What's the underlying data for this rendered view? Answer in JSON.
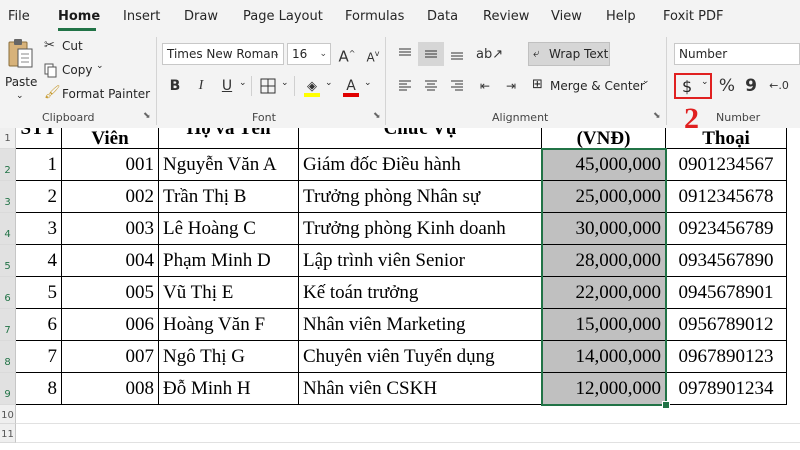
{
  "tabs": [
    "File",
    "Home",
    "Insert",
    "Draw",
    "Page Layout",
    "Formulas",
    "Data",
    "Review",
    "View",
    "Help",
    "Foxit PDF"
  ],
  "ribbon": {
    "clipboard": {
      "paste_label": "Paste",
      "cut_label": "Cut",
      "copy_label": "Copy",
      "format_painter_label": "Format Painter",
      "group_label": "Clipboard"
    },
    "font": {
      "font_name": "Times New Roman",
      "font_size": "16",
      "group_label": "Font",
      "bold": "B",
      "italic": "I",
      "underline": "U",
      "grow": "A",
      "shrink": "A",
      "font_color": "A"
    },
    "alignment": {
      "wrap_text_label": "Wrap Text",
      "merge_center_label": "Merge & Center",
      "group_label": "Alignment"
    },
    "number": {
      "format_value": "Number",
      "currency_symbol": "$",
      "percent_symbol": "%",
      "comma_symbol": "9",
      "group_label": "Number"
    }
  },
  "annotation": {
    "step_number": "2",
    "color": "#e02020"
  },
  "sheet": {
    "header": {
      "stt": "STT",
      "ma": "Viên",
      "hoten": "Họ và Tên",
      "chucvu": "Chức Vụ",
      "luong": "(VNĐ)",
      "sdt": "Thoại"
    },
    "row_numbers": [
      "1",
      "2",
      "3",
      "4",
      "5",
      "6",
      "7",
      "8",
      "9",
      "10",
      "11"
    ],
    "rows": [
      {
        "stt": "1",
        "ma": "001",
        "hoten": "Nguyễn Văn A",
        "chucvu": "Giám đốc Điều hành",
        "luong": "45,000,000",
        "sdt": "0901234567"
      },
      {
        "stt": "2",
        "ma": "002",
        "hoten": "Trần Thị B",
        "chucvu": "Trưởng phòng Nhân sự",
        "luong": "25,000,000",
        "sdt": "0912345678"
      },
      {
        "stt": "3",
        "ma": "003",
        "hoten": "Lê Hoàng C",
        "chucvu": "Trưởng phòng Kinh doanh",
        "luong": "30,000,000",
        "sdt": "0923456789"
      },
      {
        "stt": "4",
        "ma": "004",
        "hoten": "Phạm Minh D",
        "chucvu": "Lập trình viên Senior",
        "luong": "28,000,000",
        "sdt": "0934567890"
      },
      {
        "stt": "5",
        "ma": "005",
        "hoten": "Vũ Thị E",
        "chucvu": "Kế toán trưởng",
        "luong": "22,000,000",
        "sdt": "0945678901"
      },
      {
        "stt": "6",
        "ma": "006",
        "hoten": "Hoàng Văn F",
        "chucvu": "Nhân viên Marketing",
        "luong": "15,000,000",
        "sdt": "0956789012"
      },
      {
        "stt": "7",
        "ma": "007",
        "hoten": "Ngô Thị G",
        "chucvu": "Chuyên viên Tuyển dụng",
        "luong": "14,000,000",
        "sdt": "0967890123"
      },
      {
        "stt": "8",
        "ma": "008",
        "hoten": "Đỗ Minh H",
        "chucvu": "Nhân viên CSKH",
        "luong": "12,000,000",
        "sdt": "0978901234"
      }
    ]
  },
  "colors": {
    "accent": "#217346",
    "selection_fill": "#c0c0c0",
    "annotation_red": "#e02020"
  }
}
